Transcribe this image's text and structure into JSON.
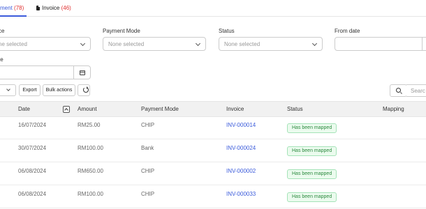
{
  "tabs": [
    {
      "label": "yment",
      "count": "(78)"
    },
    {
      "label": "Invoice",
      "count": "(46)"
    }
  ],
  "filters": {
    "source": {
      "label": "ce",
      "placeholder": "ne selected"
    },
    "payment_mode": {
      "label": "Payment Mode",
      "placeholder": "None selected"
    },
    "status": {
      "label": "Status",
      "placeholder": "None selected"
    },
    "from_date": {
      "label": "From date",
      "value": ""
    },
    "to_date": {
      "label": "te",
      "value": ""
    }
  },
  "toolbar": {
    "export_label": "Export",
    "bulk_label": "Bulk actions",
    "search_placeholder": "Searc"
  },
  "table": {
    "headers": [
      "Date",
      "Amount",
      "Payment Mode",
      "Invoice",
      "Status",
      "Mapping"
    ],
    "rows": [
      {
        "date": "16/07/2024",
        "amount": "RM25.00",
        "mode": "CHIP",
        "invoice": "INV-000014",
        "status": "Has been mapped"
      },
      {
        "date": "30/07/2024",
        "amount": "RM100.00",
        "mode": "Bank",
        "invoice": "INV-000024",
        "status": "Has been mapped"
      },
      {
        "date": "06/08/2024",
        "amount": "RM650.00",
        "mode": "CHIP",
        "invoice": "INV-000002",
        "status": "Has been mapped"
      },
      {
        "date": "06/08/2024",
        "amount": "RM100.00",
        "mode": "CHIP",
        "invoice": "INV-000033",
        "status": "Has been mapped"
      }
    ]
  },
  "colors": {
    "accent": "#3b5bdb",
    "count": "#e03131",
    "status_green": "#2b8a3e"
  },
  "icons": [
    "document-icon",
    "chevron-down-icon",
    "calendar-icon",
    "refresh-icon",
    "search-icon",
    "sort-icon"
  ]
}
